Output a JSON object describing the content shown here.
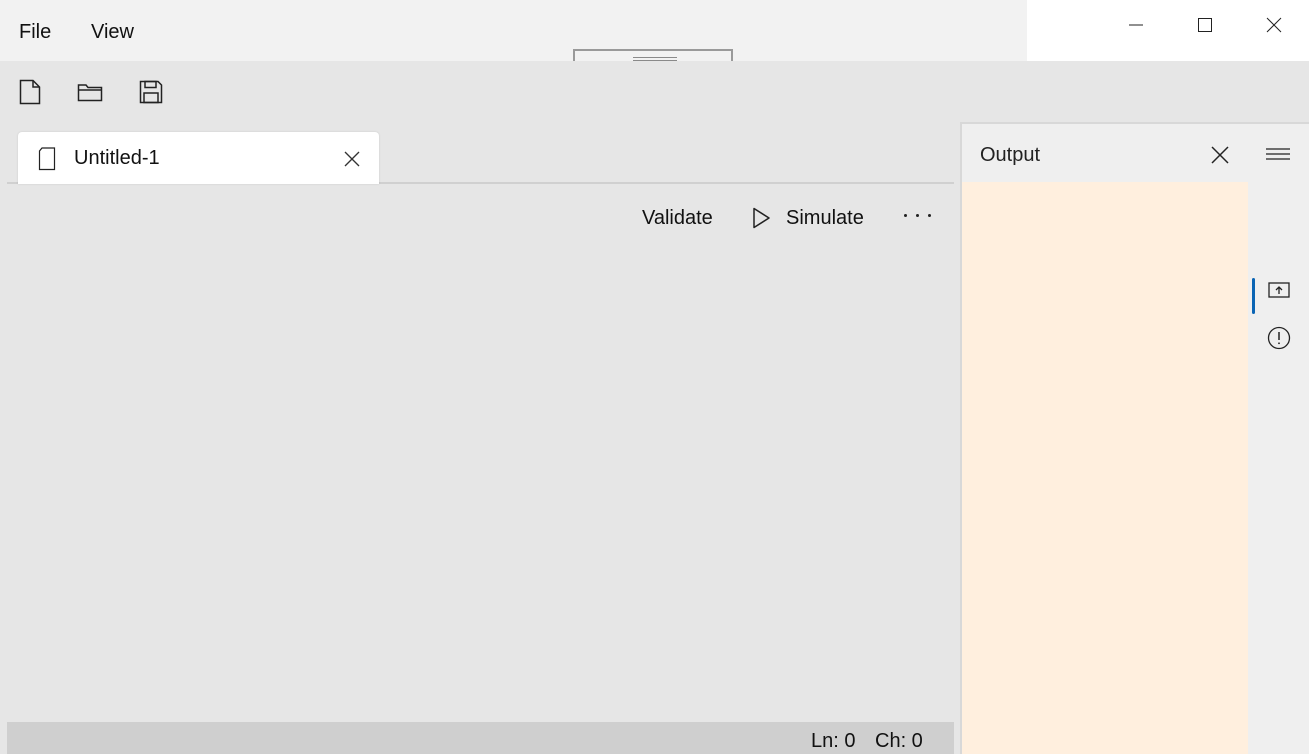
{
  "menu": {
    "file": "File",
    "view": "View"
  },
  "toolbar": {
    "new_icon": "new-file-icon",
    "open_icon": "open-folder-icon",
    "save_icon": "save-icon"
  },
  "tabs": [
    {
      "title": "Untitled-1",
      "icon": "document-icon"
    }
  ],
  "commands": {
    "validate": "Validate",
    "simulate": "Simulate",
    "more": "more-options-icon"
  },
  "status": {
    "line": "Ln: 0",
    "char": "Ch: 0"
  },
  "output": {
    "title": "Output",
    "rail": [
      "menu-icon",
      "output-icon",
      "alert-icon"
    ]
  },
  "colors": {
    "output_background": "#ffefde",
    "accent": "#0a64b4",
    "status_bar": "#cfcfcf"
  }
}
